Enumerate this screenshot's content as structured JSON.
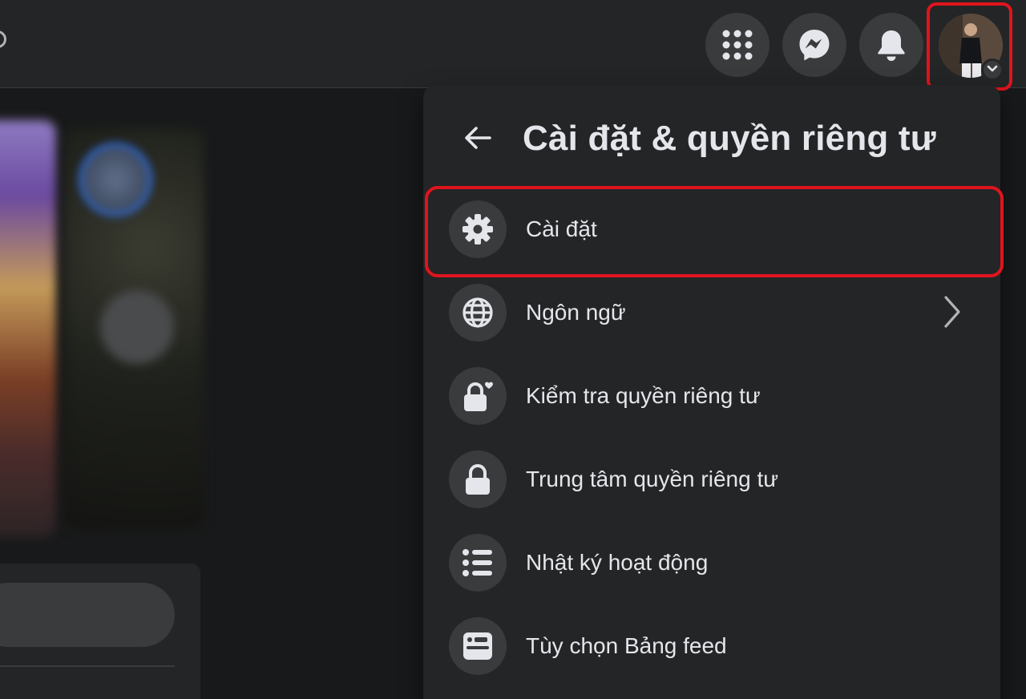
{
  "topbar": {
    "buttons": [
      {
        "name": "menu-grid",
        "icon": "grid-icon"
      },
      {
        "name": "messenger",
        "icon": "messenger-icon"
      },
      {
        "name": "notifications",
        "icon": "bell-icon"
      }
    ],
    "account": {
      "icon": "chevron-down-icon"
    }
  },
  "menu": {
    "title": "Cài đặt & quyền riêng tư",
    "items": [
      {
        "label": "Cài đặt",
        "icon": "gear-icon",
        "highlighted": true
      },
      {
        "label": "Ngôn ngữ",
        "icon": "globe-icon",
        "has_submenu": true
      },
      {
        "label": "Kiểm tra quyền riêng tư",
        "icon": "lock-heart-icon"
      },
      {
        "label": "Trung tâm quyền riêng tư",
        "icon": "lock-icon"
      },
      {
        "label": "Nhật ký hoạt động",
        "icon": "list-icon"
      },
      {
        "label": "Tùy chọn Bảng feed",
        "icon": "feed-icon"
      }
    ]
  },
  "colors": {
    "background": "#18191a",
    "surface": "#242526",
    "button": "#3a3b3c",
    "text": "#e4e6eb",
    "highlight": "#e0141e"
  }
}
